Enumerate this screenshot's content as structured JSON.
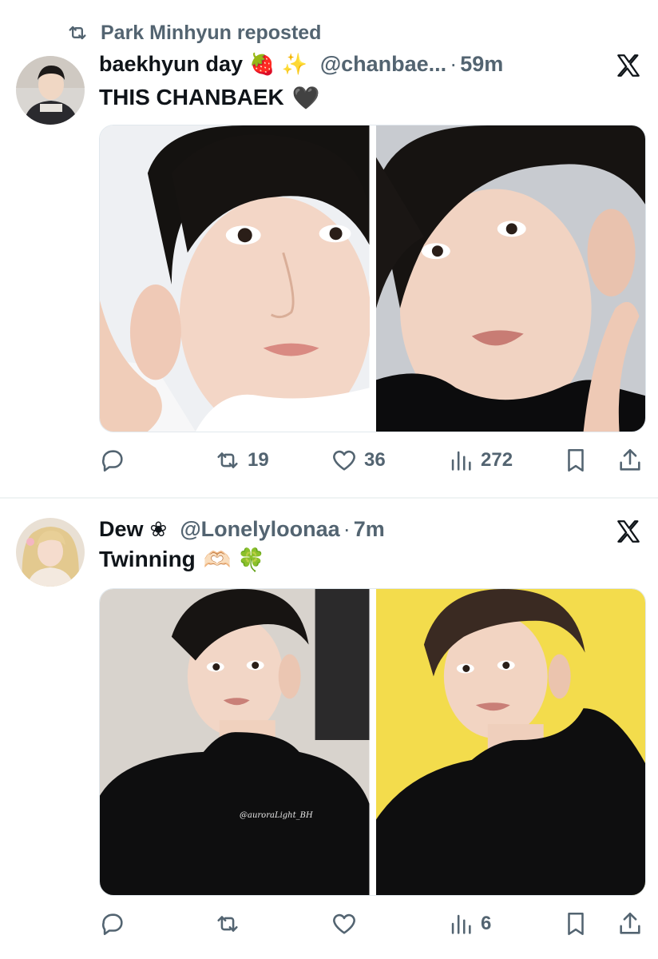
{
  "tweets": [
    {
      "repost_label": "Park Minhyun reposted",
      "display_name": "baekhyun day",
      "name_emojis": [
        "🍓",
        "✨"
      ],
      "handle": "@chanbae...",
      "dot": "·",
      "time": "59m",
      "text": "THIS CHANBAEK",
      "text_emoji": "🖤",
      "stats": {
        "replies": "",
        "reposts": "19",
        "likes": "36",
        "views": "272"
      }
    },
    {
      "display_name": "Dew",
      "name_emojis": [
        "❀"
      ],
      "handle": "@Lonelyloonaa",
      "dot": "·",
      "time": "7m",
      "text": "Twinning",
      "text_emoji": "🫶🏻 🍀",
      "photo_watermark": "@auroraLight_BH",
      "stats": {
        "replies": "",
        "reposts": "",
        "likes": "",
        "views": "6"
      }
    }
  ],
  "icons": {
    "repost": "repost-icon",
    "x_logo": "x-logo-icon",
    "reply": "reply-icon",
    "like": "heart-icon",
    "views": "views-icon",
    "bookmark": "bookmark-icon",
    "share": "share-icon"
  },
  "colors": {
    "text": "#0f1419",
    "secondary": "#536471",
    "divider": "#eff3f4"
  }
}
